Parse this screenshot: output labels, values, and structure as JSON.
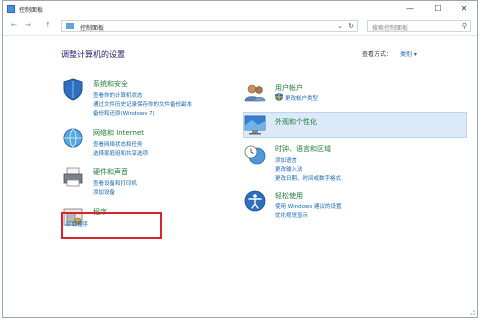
{
  "window": {
    "title": "控制面板"
  },
  "controls": {
    "minimize": "—",
    "maximize": "☐",
    "close": "✕"
  },
  "nav": {
    "back": "←",
    "forward": "→",
    "up": "↑",
    "address": "控制面板",
    "dropdown": "⌄",
    "refresh": "↻",
    "search_placeholder": "搜索控制面板"
  },
  "header": {
    "title": "调整计算机的设置",
    "view_label": "查看方式：",
    "view_value": "类别 ▾"
  },
  "categories": [
    {
      "title": "系统和安全",
      "links": [
        "查看你的计算机状态",
        "通过文件历史记录保存你的文件备份副本",
        "备份和还原(Windows 7)"
      ]
    },
    {
      "title": "网络和 Internet",
      "links": [
        "查看网络状态和任务",
        "选择家庭组和共享选项"
      ]
    },
    {
      "title": "硬件和声音",
      "links": [
        "查看设备和打印机",
        "添加设备"
      ]
    },
    {
      "title": "程序",
      "links": [
        "卸载程序"
      ]
    },
    {
      "title": "用户帐户",
      "links": [
        "更改帐户类型"
      ]
    },
    {
      "title": "外观和个性化",
      "links": []
    },
    {
      "title": "时钟、语言和区域",
      "links": [
        "添加语言",
        "更改输入法",
        "更改日期、时间或数字格式"
      ]
    },
    {
      "title": "轻松使用",
      "links": [
        "使用 Windows 建议的设置",
        "优化视觉显示"
      ]
    }
  ],
  "colors": {
    "category_title": "#1f7d36",
    "link": "#1565c0",
    "highlight_box": "#d9232d",
    "hover_row": "#dbe9f8"
  }
}
